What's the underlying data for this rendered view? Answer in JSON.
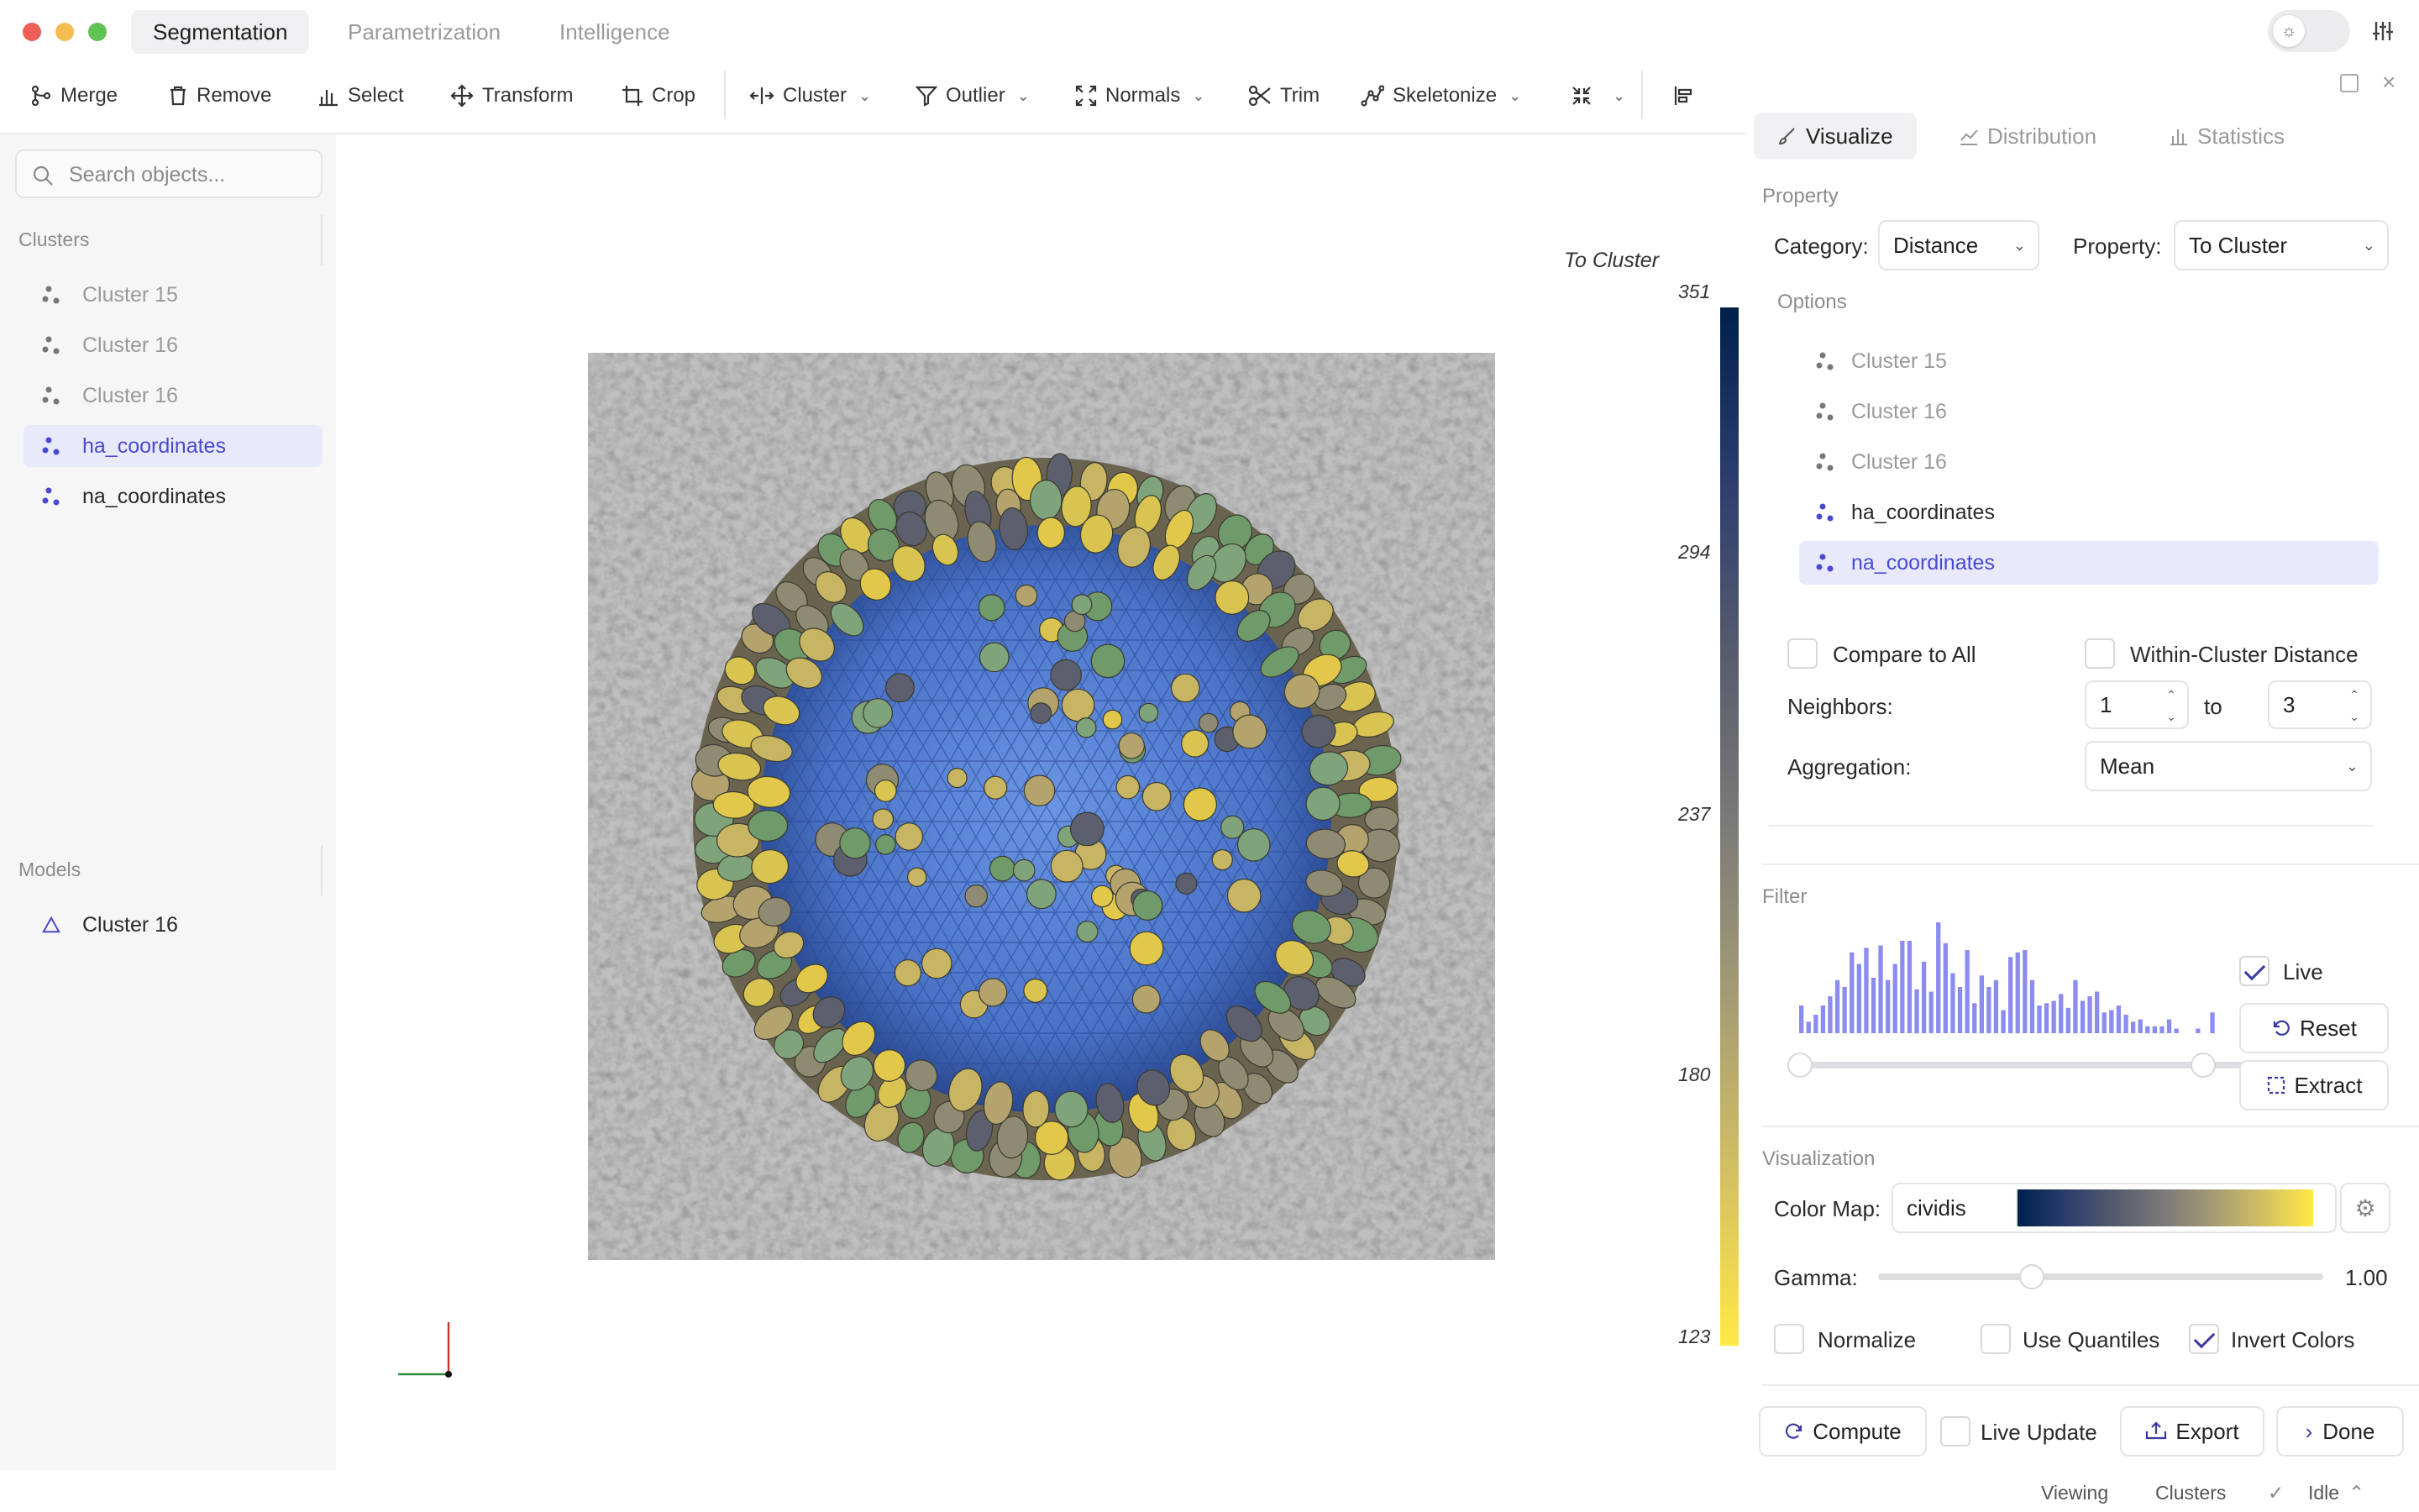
{
  "app": {
    "tabs": [
      "Segmentation",
      "Parametrization",
      "Intelligence"
    ]
  },
  "toolbar": {
    "merge": "Merge",
    "remove": "Remove",
    "select": "Select",
    "transform": "Transform",
    "crop": "Crop",
    "cluster": "Cluster",
    "outlier": "Outlier",
    "normals": "Normals",
    "trim": "Trim",
    "skeletonize": "Skeletonize"
  },
  "sidebar": {
    "search_placeholder": "Search objects...",
    "clusters_heading": "Clusters",
    "clusters": [
      "Cluster 15",
      "Cluster 16",
      "Cluster 16",
      "ha_coordinates",
      "na_coordinates"
    ],
    "models_heading": "Models",
    "models": [
      "Cluster 16"
    ]
  },
  "viewer": {
    "colorbar_title": "To Cluster",
    "ticks": [
      "351",
      "294",
      "237",
      "180",
      "123"
    ]
  },
  "panel": {
    "tabs": [
      "Visualize",
      "Distribution",
      "Statistics"
    ],
    "property_heading": "Property",
    "category_label": "Category:",
    "category_value": "Distance",
    "property_label": "Property:",
    "property_value": "To Cluster",
    "options_heading": "Options",
    "options": [
      "Cluster 15",
      "Cluster 16",
      "Cluster 16",
      "ha_coordinates",
      "na_coordinates"
    ],
    "compare_all": "Compare to All",
    "within_cluster": "Within-Cluster Distance",
    "neighbors_label": "Neighbors:",
    "neighbors_from": "1",
    "neighbors_to_label": "to",
    "neighbors_to": "3",
    "aggregation_label": "Aggregation:",
    "aggregation_value": "Mean",
    "filter_heading": "Filter",
    "live_label": "Live",
    "reset_label": "Reset",
    "extract_label": "Extract",
    "viz_heading": "Visualization",
    "colormap_label": "Color Map:",
    "colormap_value": "cividis",
    "gamma_label": "Gamma:",
    "gamma_value": "1.00",
    "normalize_label": "Normalize",
    "quantiles_label": "Use Quantiles",
    "invert_label": "Invert Colors",
    "compute_label": "Compute",
    "live_update_label": "Live Update",
    "export_label": "Export",
    "done_label": "Done"
  },
  "status": {
    "viewing": "Viewing",
    "clusters": "Clusters",
    "idle": "Idle"
  },
  "histogram": [
    12,
    5,
    8,
    12,
    16,
    23,
    20,
    35,
    30,
    37,
    24,
    38,
    23,
    30,
    40,
    40,
    19,
    31,
    18,
    48,
    39,
    26,
    20,
    36,
    13,
    25,
    20,
    23,
    10,
    33,
    35,
    36,
    23,
    12,
    13,
    14,
    17,
    11,
    23,
    14,
    16,
    18,
    9,
    10,
    12,
    8,
    5,
    6,
    3,
    3,
    3,
    6,
    2,
    0,
    0,
    2,
    0,
    9
  ],
  "colors": {
    "accent": "#4a4ad0",
    "selection_bg": "#e8e9fb",
    "cividis_start": "#00204c",
    "cividis_end": "#ffe945"
  }
}
